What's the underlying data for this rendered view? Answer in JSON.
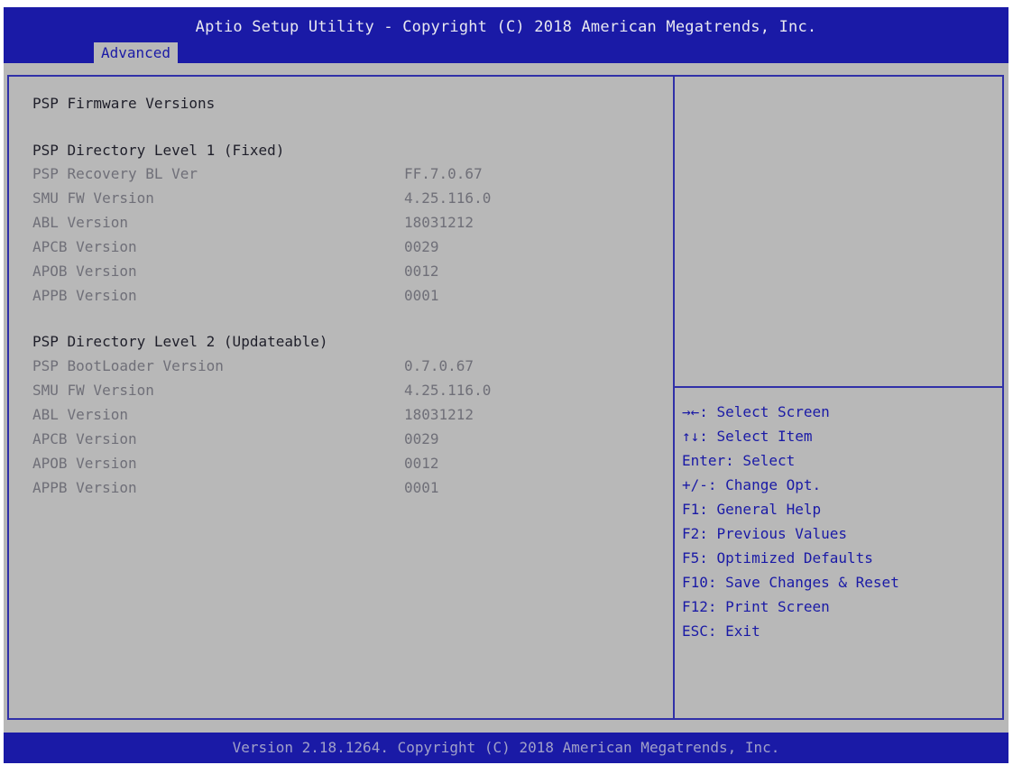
{
  "header": {
    "title": "Aptio Setup Utility - Copyright (C) 2018 American Megatrends, Inc.",
    "tab": "Advanced"
  },
  "main": {
    "heading": "PSP Firmware Versions",
    "level1": {
      "title": "PSP Directory Level 1 (Fixed)",
      "rows": [
        {
          "label": "PSP Recovery BL Ver",
          "value": "FF.7.0.67"
        },
        {
          "label": "SMU FW Version",
          "value": "4.25.116.0"
        },
        {
          "label": "ABL Version",
          "value": "18031212"
        },
        {
          "label": "APCB Version",
          "value": "0029"
        },
        {
          "label": "APOB Version",
          "value": "0012"
        },
        {
          "label": "APPB Version",
          "value": "0001"
        }
      ]
    },
    "level2": {
      "title": "PSP Directory Level 2 (Updateable)",
      "rows": [
        {
          "label": "PSP BootLoader Version",
          "value": "0.7.0.67"
        },
        {
          "label": "SMU FW Version",
          "value": "4.25.116.0"
        },
        {
          "label": "ABL Version",
          "value": "18031212"
        },
        {
          "label": "APCB Version",
          "value": "0029"
        },
        {
          "label": "APOB Version",
          "value": "0012"
        },
        {
          "label": "APPB Version",
          "value": "0001"
        }
      ]
    }
  },
  "help": {
    "keys": [
      "→←: Select Screen",
      "↑↓: Select Item",
      "Enter: Select",
      "+/-: Change Opt.",
      "F1: General Help",
      "F2: Previous Values",
      "F5: Optimized Defaults",
      "F10: Save Changes & Reset",
      "F12: Print Screen",
      "ESC: Exit"
    ]
  },
  "footer": {
    "text": "Version 2.18.1264. Copyright (C) 2018 American Megatrends, Inc."
  },
  "colors": {
    "background": "#b8b8b8",
    "bar": "#1a1aa6",
    "border": "#3030a8",
    "text": "#1f1f2a",
    "dim_text": "#6f6f78",
    "help_text": "#1a1aa6"
  }
}
